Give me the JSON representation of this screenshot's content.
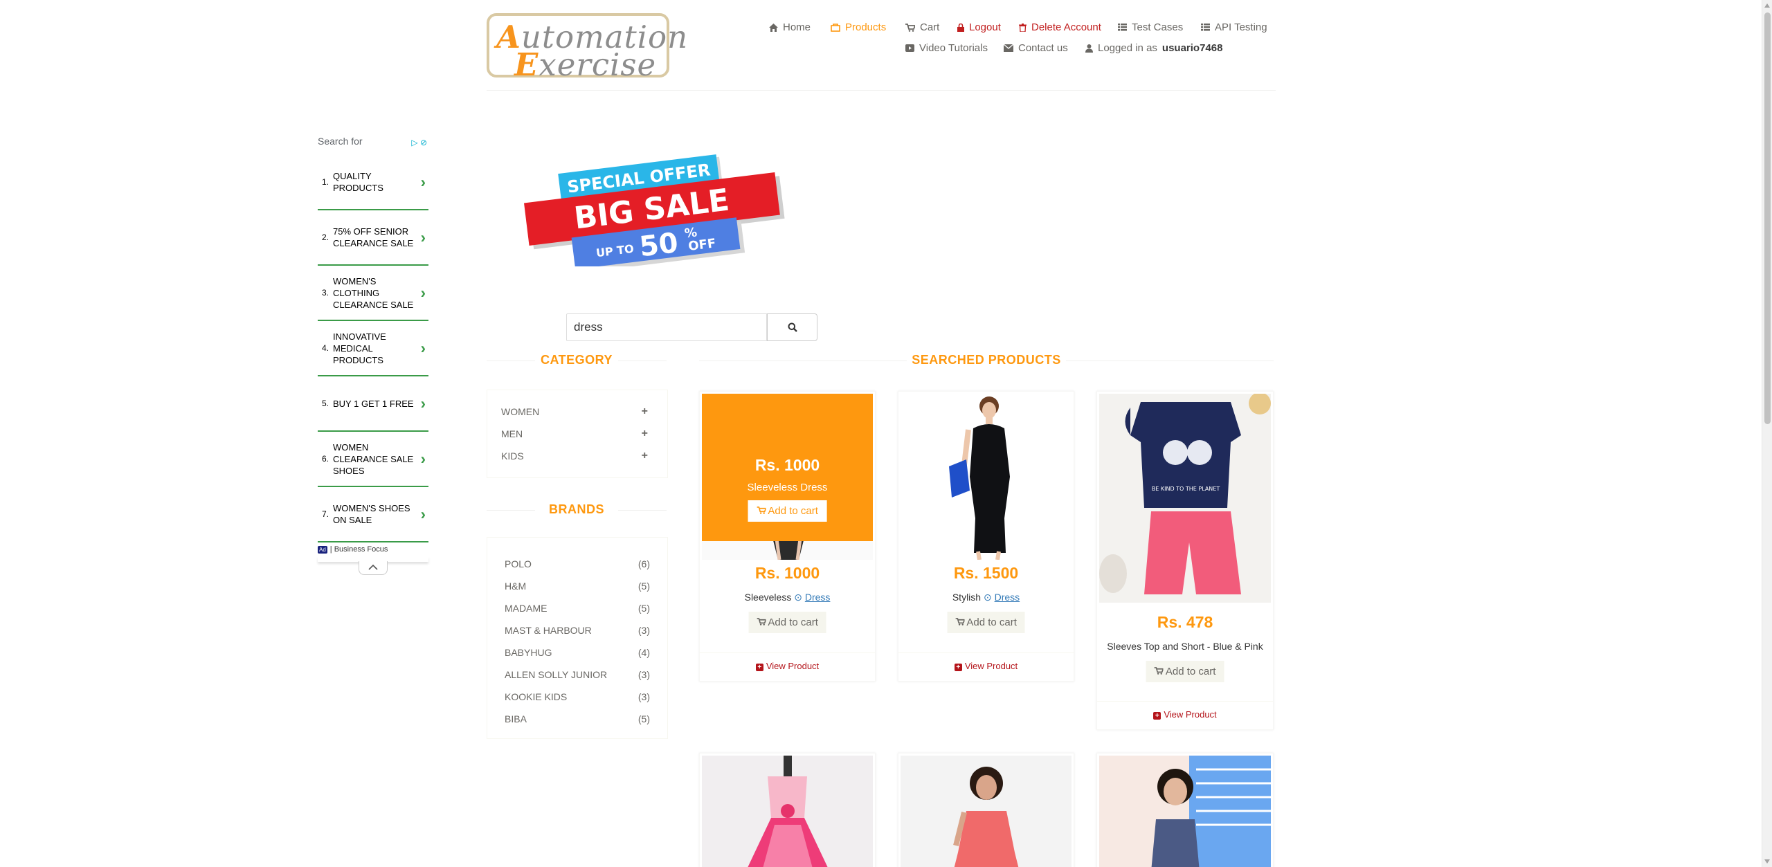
{
  "header": {
    "logo_line1": "Automation",
    "logo_line2": "Exercise",
    "nav": {
      "home": "Home",
      "products": "Products",
      "cart": "Cart",
      "logout": "Logout",
      "delete_account": "Delete Account",
      "test_cases": "Test Cases",
      "api_testing": "API Testing",
      "video_tutorials": "Video Tutorials",
      "contact_us": "Contact us",
      "logged_in_prefix": "Logged in as",
      "username": "usuario7468"
    }
  },
  "ad": {
    "search_for": "Search for",
    "items": [
      {
        "num": "1.",
        "text": "QUALITY PRODUCTS"
      },
      {
        "num": "2.",
        "text": "75% OFF SENIOR CLEARANCE SALE"
      },
      {
        "num": "3.",
        "text": "WOMEN'S CLOTHING CLEARANCE SALE"
      },
      {
        "num": "4.",
        "text": "INNOVATIVE MEDICAL PRODUCTS"
      },
      {
        "num": "5.",
        "text": "BUY 1 GET 1 FREE"
      },
      {
        "num": "6.",
        "text": "WOMEN CLEARANCE SALE SHOES"
      },
      {
        "num": "7.",
        "text": "WOMEN'S SHOES ON SALE"
      }
    ],
    "badge": "Ad",
    "footer": "| Business Focus"
  },
  "banner": {
    "line1": "SPECIAL OFFER",
    "line2": "BIG SALE",
    "line3_small": "UP TO",
    "line3_big": "50",
    "line3_pct": "%",
    "line3_off": "OFF"
  },
  "search": {
    "value": "dress"
  },
  "sidebar": {
    "category_title": "CATEGORY",
    "categories": [
      "WOMEN",
      "MEN",
      "KIDS"
    ],
    "brands_title": "BRANDS",
    "brands": [
      {
        "name": "POLO",
        "count": "(6)"
      },
      {
        "name": "H&M",
        "count": "(5)"
      },
      {
        "name": "MADAME",
        "count": "(5)"
      },
      {
        "name": "MAST & HARBOUR",
        "count": "(3)"
      },
      {
        "name": "BABYHUG",
        "count": "(4)"
      },
      {
        "name": "ALLEN SOLLY JUNIOR",
        "count": "(3)"
      },
      {
        "name": "KOOKIE KIDS",
        "count": "(3)"
      },
      {
        "name": "BIBA",
        "count": "(5)"
      }
    ]
  },
  "products_title": "SEARCHED PRODUCTS",
  "products": [
    {
      "price": "Rs. 1000",
      "name_prefix": "Sleeveless",
      "name_tag": "Dress",
      "overlay_name": "Sleeveless Dress",
      "add": "Add to cart",
      "view": "View Product"
    },
    {
      "price": "Rs. 1500",
      "name_prefix": "Stylish",
      "name_tag": "Dress",
      "add": "Add to cart",
      "view": "View Product"
    },
    {
      "price": "Rs. 478",
      "name": "Sleeves Top and Short - Blue & Pink",
      "add": "Add to cart",
      "view": "View Product"
    }
  ],
  "colors": {
    "accent": "#fe980f",
    "link_red": "#c11f1f",
    "ad_green": "#3a9b48"
  }
}
